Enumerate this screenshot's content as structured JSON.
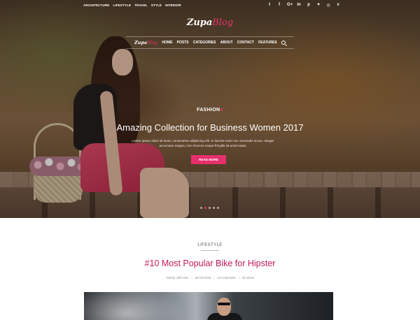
{
  "topbar": {
    "links": [
      "ARCHITECTURE",
      "LIFESTYLE",
      "TRAVEL",
      "STYLE",
      "INTERIOR"
    ],
    "social_icons": [
      {
        "name": "twitter-icon",
        "glyph": "t"
      },
      {
        "name": "facebook-icon",
        "glyph": "f"
      },
      {
        "name": "google-plus-icon",
        "glyph": "G+"
      },
      {
        "name": "linkedin-icon",
        "glyph": "in"
      },
      {
        "name": "pinterest-icon",
        "glyph": "p"
      },
      {
        "name": "heart-icon",
        "glyph": "♥"
      },
      {
        "name": "rss-icon",
        "glyph": "◎"
      },
      {
        "name": "vine-icon",
        "glyph": "v"
      }
    ]
  },
  "logo": {
    "part1": "Zupa",
    "part2": "Blog"
  },
  "nav": {
    "mini_logo_part1": "Zupa",
    "mini_logo_part2": "Blog",
    "items": [
      "HOME",
      "POSTS",
      "CATEGORIES",
      "ABOUT",
      "CONTACT",
      "FEATURES"
    ]
  },
  "hero": {
    "category": "FASHION",
    "title": "Amazing Collection for Business Women 2017",
    "excerpt": "Lorem ipsum dolor sit amet, consectetur adipiscing elit. In laoreet enim nec venenatis luctus. Integer accumsan magna, non rhoncus neque fringilla sit amet turpis.",
    "button": "READ MORE",
    "slides": 5,
    "active_slide": 1
  },
  "post": {
    "category": "LIFESTYLE",
    "title": "#10 Most Popular Bike for Hipster",
    "meta": {
      "author": "Add by John Doe",
      "date": "30 Oct 2016",
      "comments": "12 Comments",
      "views": "20 Views"
    }
  },
  "colors": {
    "accent": "#e5306b",
    "post_title": "#c2185b"
  }
}
